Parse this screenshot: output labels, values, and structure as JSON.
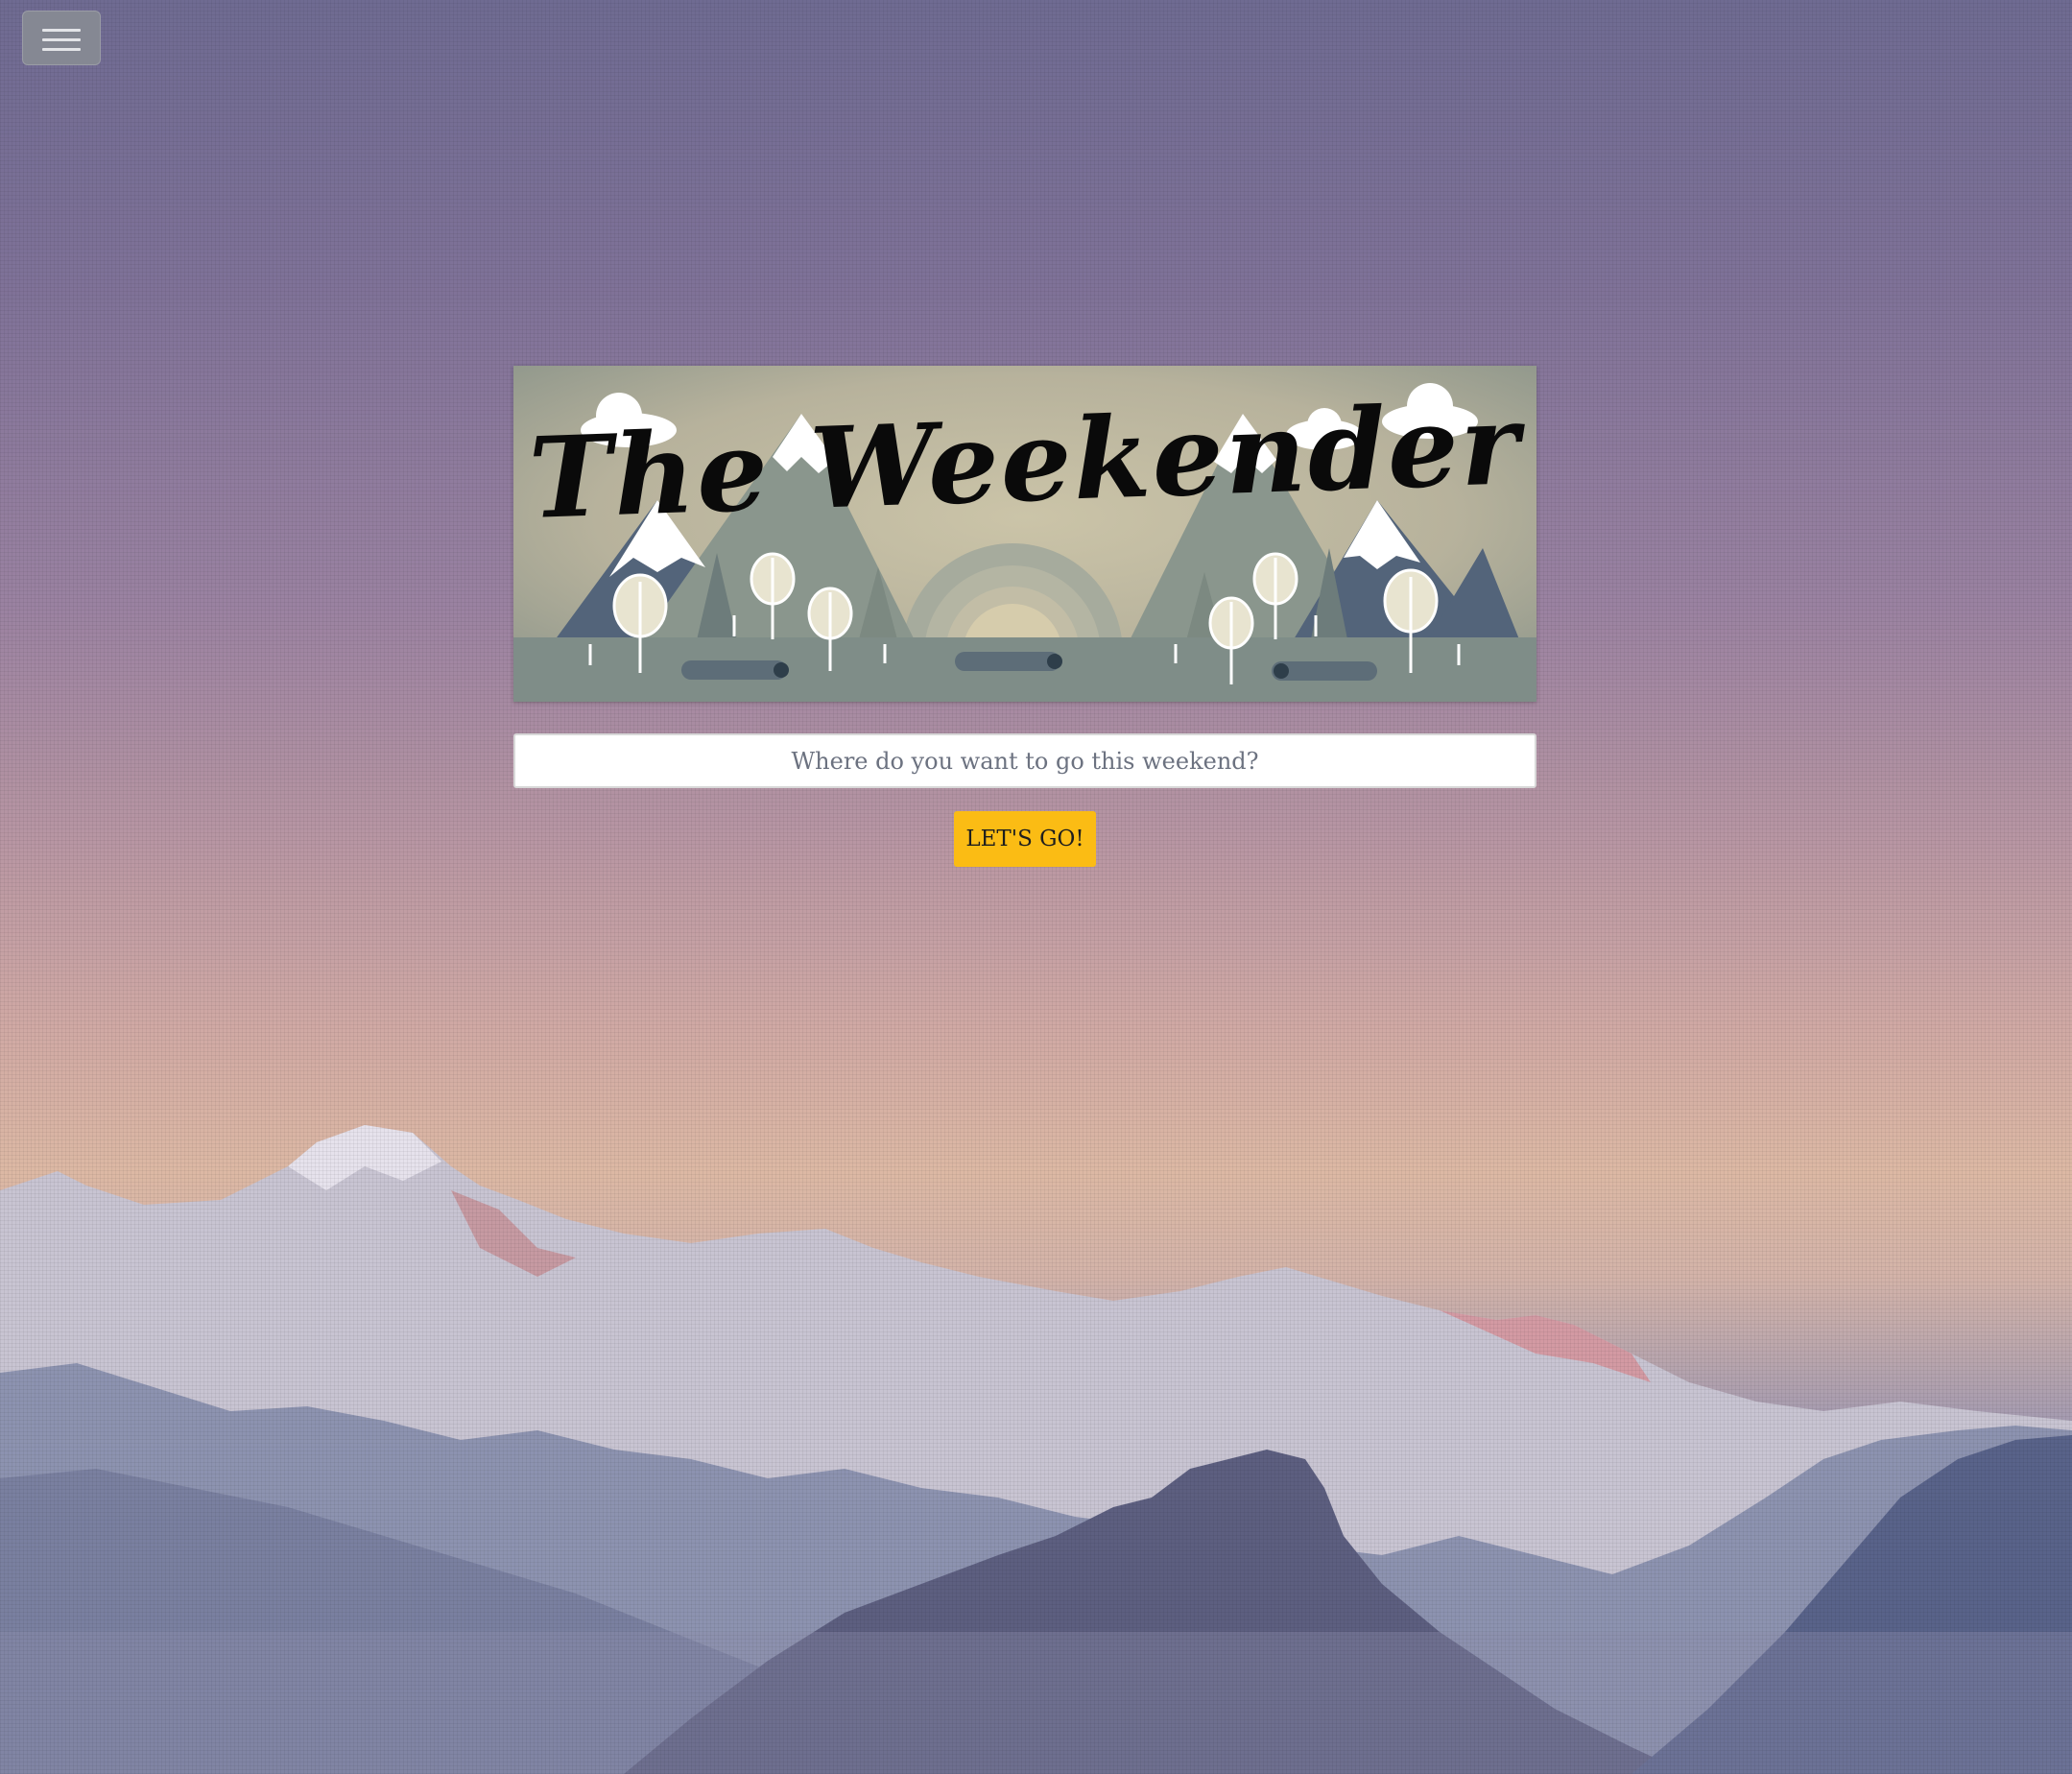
{
  "navbar": {
    "menu_toggle_icon": "hamburger-menu-icon"
  },
  "hero": {
    "banner_title": "The Weekender",
    "search": {
      "placeholder": "Where do you want to go this weekend?",
      "value": ""
    },
    "go_button_label": "LET'S GO!"
  },
  "colors": {
    "accent_button": "#fbbc14",
    "banner_background": "#c1b9a0"
  }
}
